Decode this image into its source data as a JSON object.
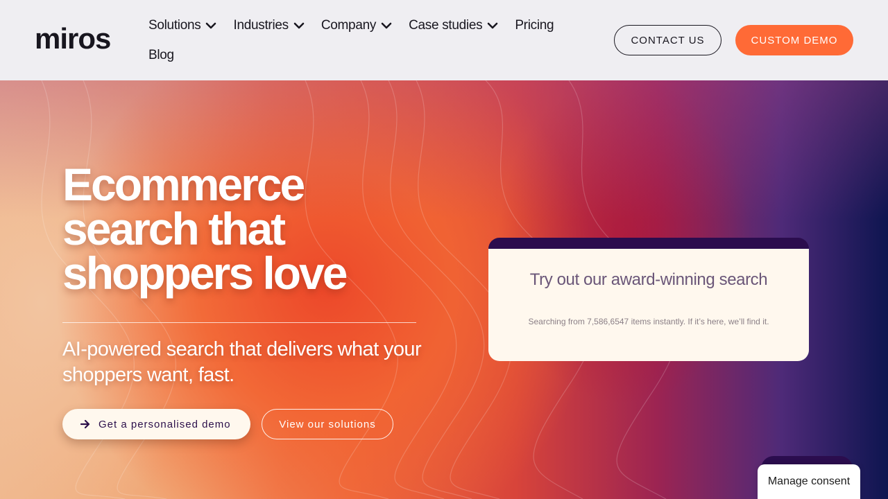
{
  "header": {
    "logo_text": "miros",
    "nav": [
      {
        "label": "Solutions",
        "has_dropdown": true
      },
      {
        "label": "Industries",
        "has_dropdown": true
      },
      {
        "label": "Company",
        "has_dropdown": true
      },
      {
        "label": "Case studies",
        "has_dropdown": true
      },
      {
        "label": "Pricing",
        "has_dropdown": false
      },
      {
        "label": "Blog",
        "has_dropdown": false
      }
    ],
    "contact_label": "CONTACT US",
    "demo_label": "CUSTOM DEMO"
  },
  "hero": {
    "headline_lines": [
      "Ecommerce",
      "search that",
      "shoppers love"
    ],
    "subhead": "AI-powered search that delivers what your shoppers want, fast.",
    "primary_cta": "Get a personalised demo",
    "secondary_cta": "View our solutions"
  },
  "search_card": {
    "title": "Try out our award-winning search",
    "subtitle": "Searching from 7,586,6547 items instantly. If it’s here, we’ll find it."
  },
  "consent": {
    "label": "Manage consent"
  },
  "colors": {
    "accent": "#ff6a36",
    "dark_purple": "#2b0d4e",
    "card_bg": "#fff8ee",
    "header_bg": "#efeef2"
  }
}
